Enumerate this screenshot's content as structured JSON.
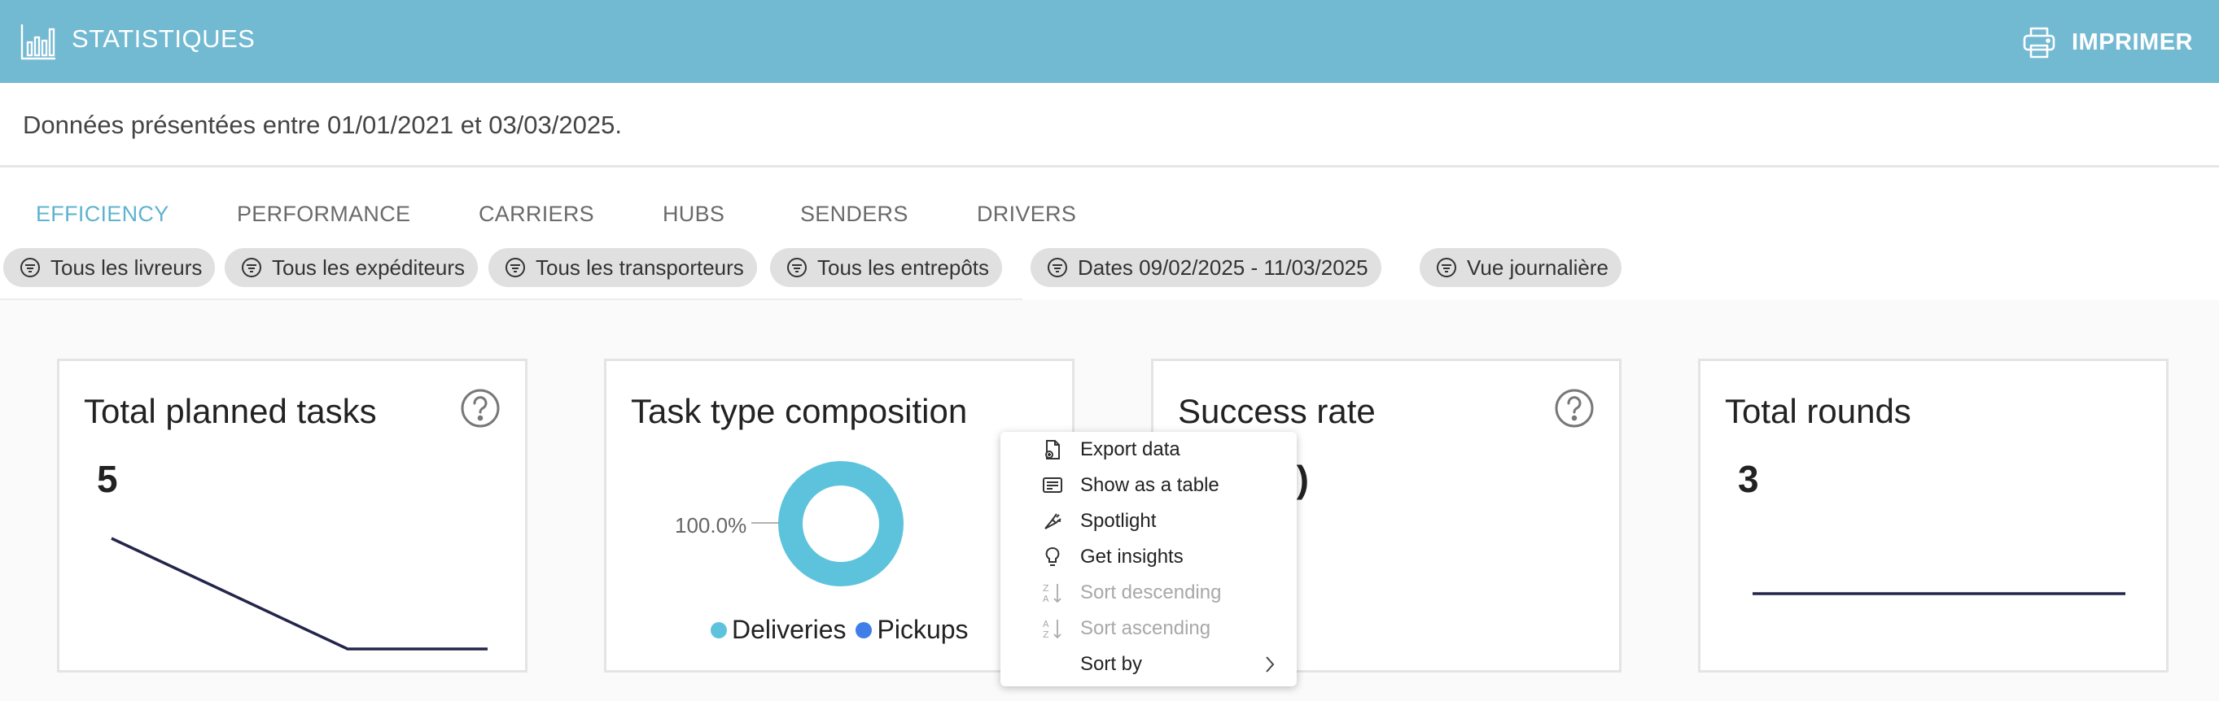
{
  "header": {
    "title": "STATISTIQUES",
    "print_label": "IMPRIMER"
  },
  "date_range_text": "Données présentées entre 01/01/2021 et 03/03/2025.",
  "tabs": [
    {
      "label": "EFFICIENCY",
      "active": true
    },
    {
      "label": "PERFORMANCE",
      "active": false
    },
    {
      "label": "CARRIERS",
      "active": false
    },
    {
      "label": "HUBS",
      "active": false
    },
    {
      "label": "SENDERS",
      "active": false
    },
    {
      "label": "DRIVERS",
      "active": false
    }
  ],
  "filters": [
    {
      "label": "Tous les livreurs"
    },
    {
      "label": "Tous les expéditeurs"
    },
    {
      "label": "Tous les transporteurs"
    },
    {
      "label": "Tous les entrepôts"
    },
    {
      "label": "Dates 09/02/2025 - 11/03/2025"
    },
    {
      "label": "Vue journalière"
    }
  ],
  "cards": {
    "planned": {
      "title": "Total planned tasks",
      "value": "5"
    },
    "composition": {
      "title": "Task type composition",
      "donut_label": "100.0%",
      "legend": [
        {
          "label": "Deliveries",
          "color": "#5dc3dc"
        },
        {
          "label": "Pickups",
          "color": "#3f7ee8"
        }
      ]
    },
    "success": {
      "title": "Success rate",
      "value_fragment": "x)"
    },
    "rounds": {
      "title": "Total rounds",
      "value": "3"
    }
  },
  "context_menu": {
    "items": [
      {
        "label": "Export data",
        "icon": "export-icon",
        "disabled": false
      },
      {
        "label": "Show as a table",
        "icon": "table-icon",
        "disabled": false
      },
      {
        "label": "Spotlight",
        "icon": "spotlight-icon",
        "disabled": false
      },
      {
        "label": "Get insights",
        "icon": "lightbulb-icon",
        "disabled": false
      },
      {
        "label": "Sort descending",
        "icon": "sort-desc-icon",
        "disabled": true
      },
      {
        "label": "Sort ascending",
        "icon": "sort-asc-icon",
        "disabled": true
      },
      {
        "label": "Sort by",
        "icon": "",
        "disabled": false,
        "submenu": true
      }
    ]
  },
  "colors": {
    "header_bg": "#72b9d2",
    "active_tab": "#5fb3cf",
    "line": "#23264a",
    "donut": "#5dc3dc"
  }
}
